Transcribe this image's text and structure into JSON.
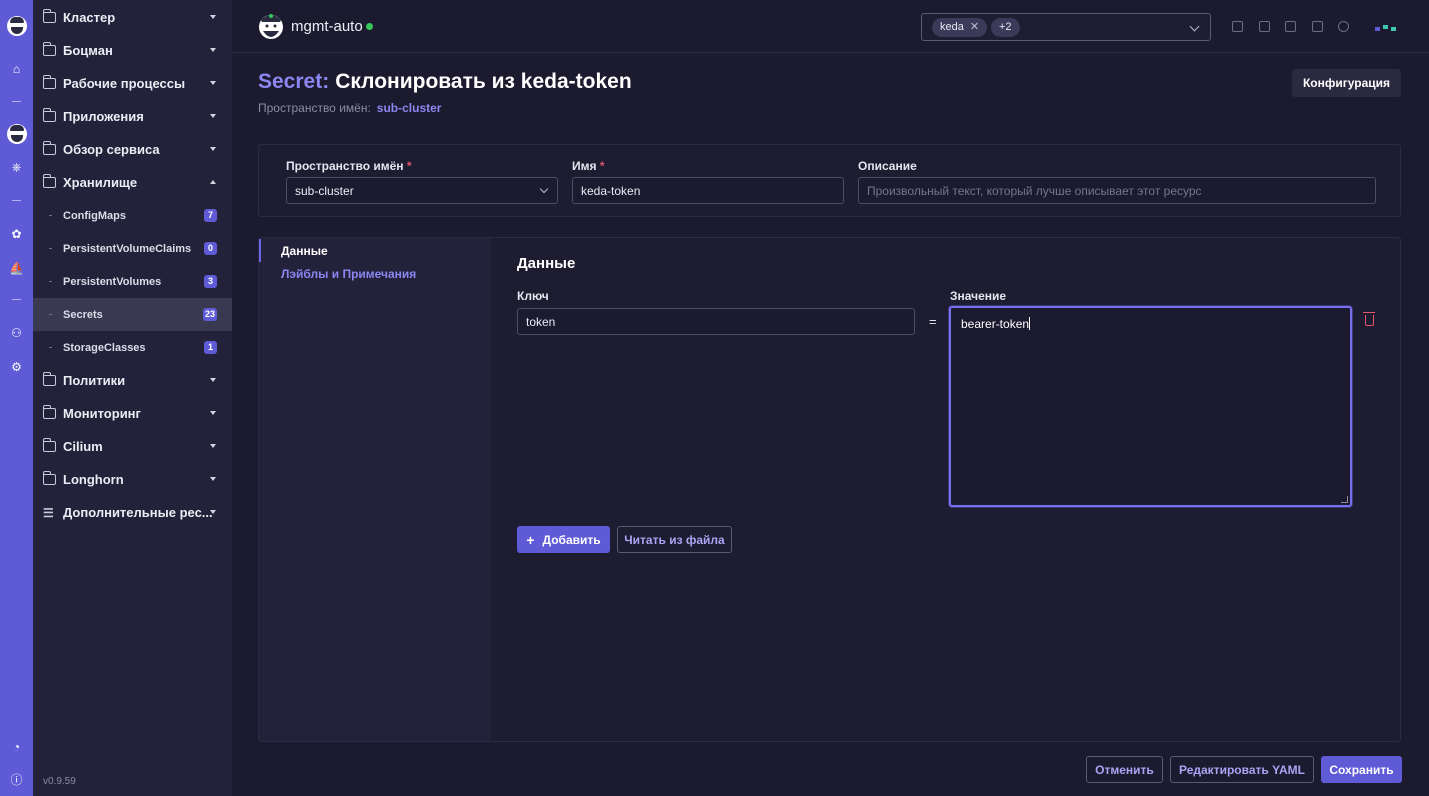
{
  "app": {
    "version": "v0.9.59"
  },
  "sidebar": {
    "groups": [
      {
        "label": "Кластер",
        "expanded": false
      },
      {
        "label": "Боцман",
        "expanded": false
      },
      {
        "label": "Рабочие процессы",
        "expanded": false
      },
      {
        "label": "Приложения",
        "expanded": false
      },
      {
        "label": "Обзор сервиса",
        "expanded": false
      },
      {
        "label": "Хранилище",
        "expanded": true
      }
    ],
    "storage_items": [
      {
        "label": "ConfigMaps",
        "count": "7"
      },
      {
        "label": "PersistentVolumeClaims",
        "count": "0"
      },
      {
        "label": "PersistentVolumes",
        "count": "3"
      },
      {
        "label": "Secrets",
        "count": "23",
        "active": true
      },
      {
        "label": "StorageClasses",
        "count": "1"
      }
    ],
    "groups_after": [
      {
        "label": "Политики"
      },
      {
        "label": "Мониторинг"
      },
      {
        "label": "Cilium"
      },
      {
        "label": "Longhorn"
      },
      {
        "label": "Дополнительные рес..."
      }
    ]
  },
  "topbar": {
    "cluster_name": "mgmt-auto",
    "status_color": "#34c759",
    "namespace_chips": [
      "keda",
      "+2"
    ]
  },
  "header": {
    "kind": "Secret:",
    "title": "Склонировать из keda-token",
    "namespace_label": "Пространство имён:",
    "namespace_value": "sub-cluster",
    "config_button": "Конфигурация"
  },
  "form": {
    "namespace": {
      "label": "Пространство имён",
      "required": "*",
      "value": "sub-cluster"
    },
    "name": {
      "label": "Имя",
      "required": "*",
      "value": "keda-token"
    },
    "description": {
      "label": "Описание",
      "placeholder": "Произвольный текст, который лучше описывает этот ресурс"
    }
  },
  "tabs": [
    {
      "label": "Данные",
      "active": true
    },
    {
      "label": "Лэйблы и Примечания",
      "active": false
    }
  ],
  "data_section": {
    "title": "Данные",
    "key_label": "Ключ",
    "value_label": "Значение",
    "key_value": "token",
    "equals": "=",
    "value_value": "bearer-token",
    "add_button": "Добавить",
    "add_icon": "+",
    "read_file_button": "Читать из файла"
  },
  "footer": {
    "cancel": "Отменить",
    "edit_yaml": "Редактировать YAML",
    "save": "Сохранить"
  },
  "colors": {
    "accent": "#5f5bd6",
    "accent_text": "#8b86f0",
    "danger": "#e5556d"
  }
}
